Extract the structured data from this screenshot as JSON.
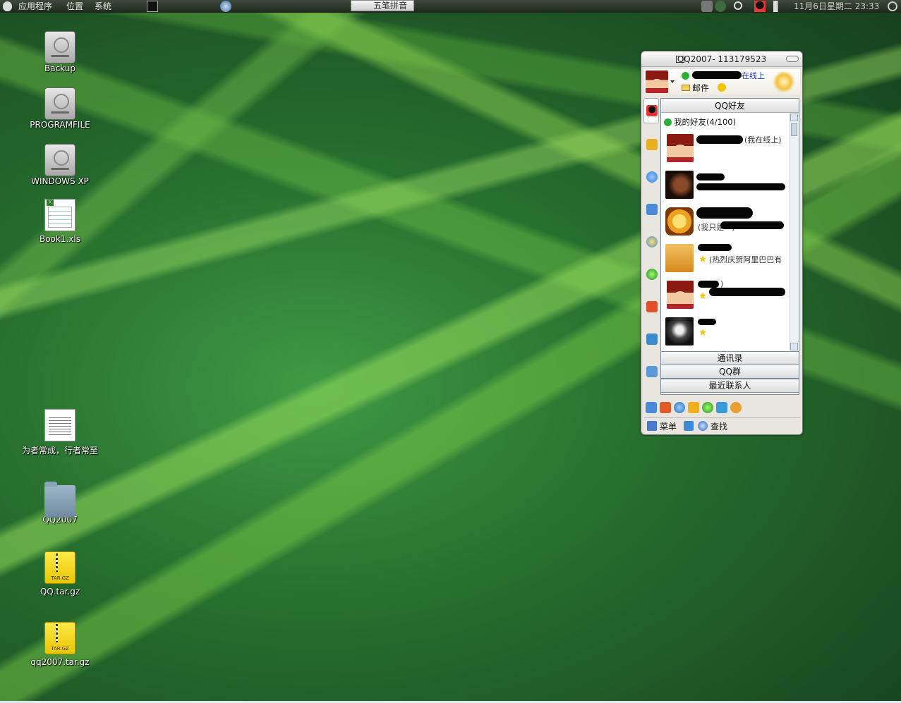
{
  "panel": {
    "menu_apps": "应用程序",
    "menu_places": "位置",
    "menu_system": "系统",
    "ime": "五笔拼音",
    "datetime": "11月6日星期二 23:33"
  },
  "desktop": {
    "icons": [
      {
        "label": "Backup"
      },
      {
        "label": "PROGRAMFILE"
      },
      {
        "label": "WINDOWS XP"
      },
      {
        "label": "Book1.xls"
      },
      {
        "label": "为者常成，行者常至"
      },
      {
        "label": "QQ2007"
      },
      {
        "label": "QQ.tar.gz"
      },
      {
        "label": "qq2007.tar.gz"
      }
    ]
  },
  "qq": {
    "title": "QQ2007- 113179523",
    "profile_status": "在线上",
    "mail_label": "邮件",
    "tab_friends": "QQ好友",
    "group_label": "我的好友(4/100)",
    "friends": [
      {
        "name": "",
        "signature": "(我在线上)"
      },
      {
        "name": "",
        "signature": ""
      },
      {
        "name": "",
        "signature": "(我只是一)"
      },
      {
        "name": "",
        "signature": "(热烈庆贺阿里巴巴有"
      },
      {
        "name": "",
        "signature": ")"
      },
      {
        "name": "",
        "signature": ""
      }
    ],
    "tab_contacts": "通讯录",
    "tab_groups": "QQ群",
    "tab_recent": "最近联系人",
    "menu_label": "菜单",
    "find_label": "查找"
  }
}
